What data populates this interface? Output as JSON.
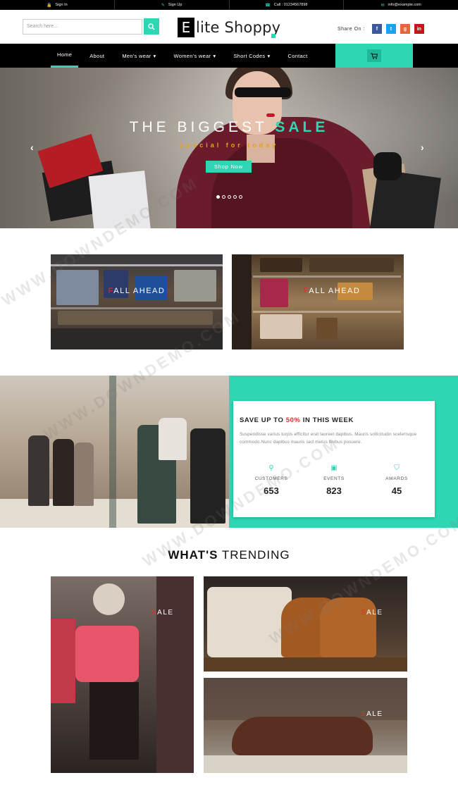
{
  "topbar": {
    "signin": "Sign In",
    "signup": "Sign Up",
    "call": "Call : 01234567898",
    "email": "info@example.com"
  },
  "header": {
    "search_placeholder": "Search here...",
    "logo_initial": "E",
    "logo_rest": "lite Shoppy",
    "share_label": "Share On :",
    "social": [
      {
        "label": "f",
        "color": "#3b5998"
      },
      {
        "label": "t",
        "color": "#1da1f2"
      },
      {
        "label": "g",
        "color": "#e8663d"
      },
      {
        "label": "in",
        "color": "#c4161c"
      }
    ]
  },
  "nav": {
    "items": [
      {
        "label": "Home",
        "caret": ""
      },
      {
        "label": "About",
        "caret": ""
      },
      {
        "label": "Men's wear",
        "caret": "▾"
      },
      {
        "label": "Women's wear",
        "caret": "▾"
      },
      {
        "label": "Short Codes",
        "caret": "▾"
      },
      {
        "label": "Contact",
        "caret": ""
      }
    ]
  },
  "hero": {
    "title_main": "THE BIGGEST ",
    "title_accent": "SALE",
    "subtitle": "Special for today",
    "button": "Shop Now"
  },
  "promos": [
    {
      "first": "F",
      "rest": "ALL AHEAD"
    },
    {
      "first": "F",
      "rest": "ALL AHEAD"
    }
  ],
  "save": {
    "head_pre": "SAVE UP TO ",
    "head_pct": "50%",
    "head_post": " IN THIS WEEK",
    "desc": "Suspendisse varius turpis efficitur erat laoreet dapibus. Mauris sollicitudin scelerisque commodo.Nunc dapibus mauris sed metus finibus posuere.",
    "stats": [
      {
        "icon": "⚲",
        "label": "CUSTOMERS",
        "value": "653"
      },
      {
        "icon": "▣",
        "label": "EVENTS",
        "value": "823"
      },
      {
        "icon": "⛉",
        "label": "AWARDS",
        "value": "45"
      }
    ]
  },
  "trending": {
    "title_bold": "WHAT'S",
    "title_rest": " TRENDING",
    "labels": [
      {
        "first": "S",
        "rest": "ALE"
      },
      {
        "first": "S",
        "rest": "ALE"
      },
      {
        "first": "S",
        "rest": "ALE"
      }
    ]
  },
  "watermark": "WWW.DOWNDEMO.COM",
  "colors": {
    "accent": "#2fd6b4",
    "red": "#e52d27",
    "gold": "#e6a21a"
  }
}
